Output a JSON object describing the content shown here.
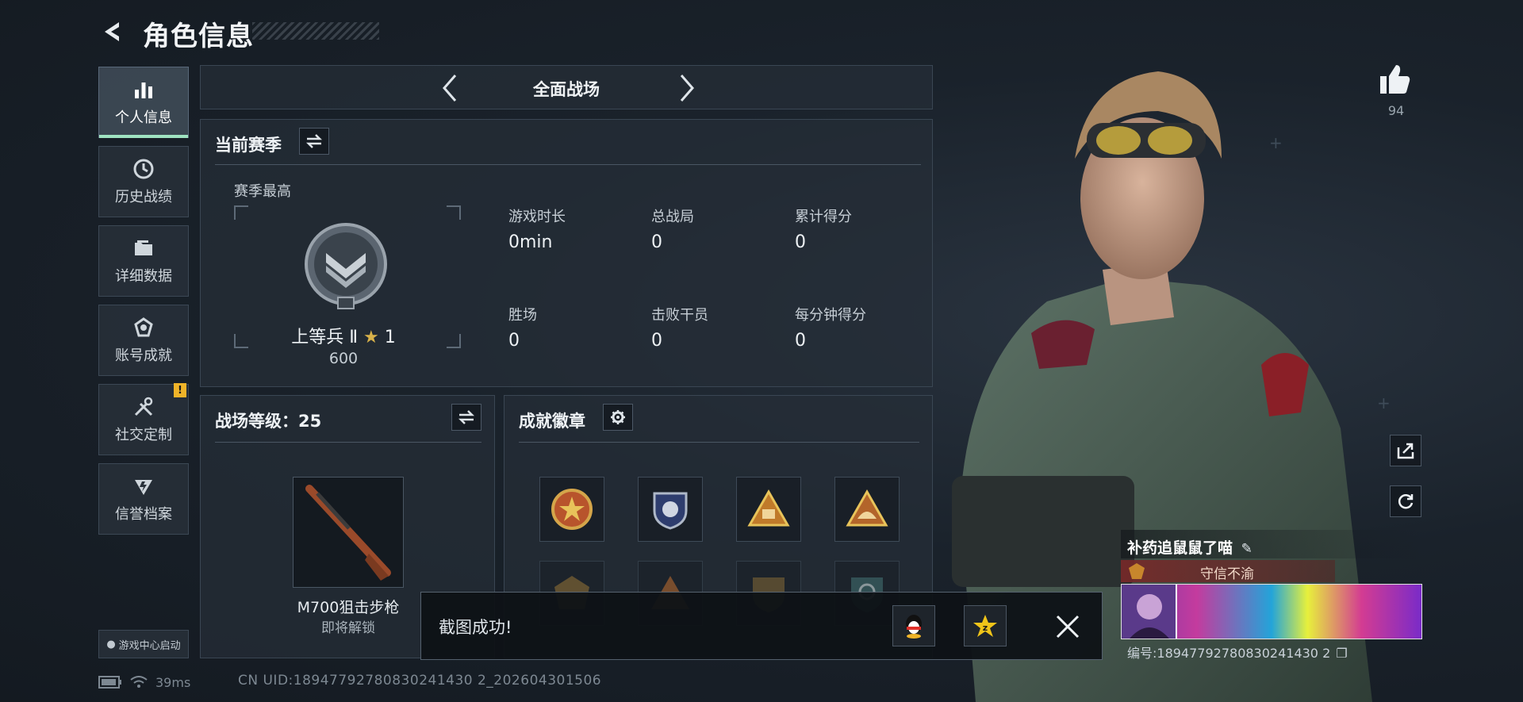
{
  "header": {
    "title": "角色信息"
  },
  "sidebar": {
    "items": [
      {
        "label": "个人信息",
        "icon": "bar-chart-icon",
        "active": true
      },
      {
        "label": "历史战绩",
        "icon": "history-clock-icon"
      },
      {
        "label": "详细数据",
        "icon": "folder-icon"
      },
      {
        "label": "账号成就",
        "icon": "medal-icon"
      },
      {
        "label": "社交定制",
        "icon": "tools-icon",
        "alert": "!"
      },
      {
        "label": "信誉档案",
        "icon": "shield-bolt-icon"
      }
    ],
    "launch_label": "游戏中心启动"
  },
  "status": {
    "ping": "39ms",
    "uid": "CN UID:18947792780830241430 2_202604301506"
  },
  "mode": {
    "name": "全面战场"
  },
  "season": {
    "title": "当前赛季",
    "best_label": "赛季最高",
    "rank_name": "上等兵 Ⅱ",
    "rank_stars": "1",
    "rank_score": "600",
    "stats": [
      {
        "label": "游戏时长",
        "value": "0min"
      },
      {
        "label": "总战局",
        "value": "0"
      },
      {
        "label": "累计得分",
        "value": "0"
      },
      {
        "label": "胜场",
        "value": "0"
      },
      {
        "label": "击败干员",
        "value": "0"
      },
      {
        "label": "每分钟得分",
        "value": "0"
      }
    ]
  },
  "battlefield": {
    "title": "战场等级：25",
    "weapon_name": "M700狙击步枪",
    "weapon_status": "即将解锁"
  },
  "badges": {
    "title": "成就徽章"
  },
  "toast": {
    "text": "截图成功!"
  },
  "likes": {
    "count": "94"
  },
  "player": {
    "name": "补药追鼠鼠了喵",
    "title": "守信不渝",
    "id": "编号:18947792780830241430 2"
  },
  "colors": {
    "accent": "#9fe3c1",
    "alert": "#f0b429",
    "title_bar": "#7a2828"
  }
}
